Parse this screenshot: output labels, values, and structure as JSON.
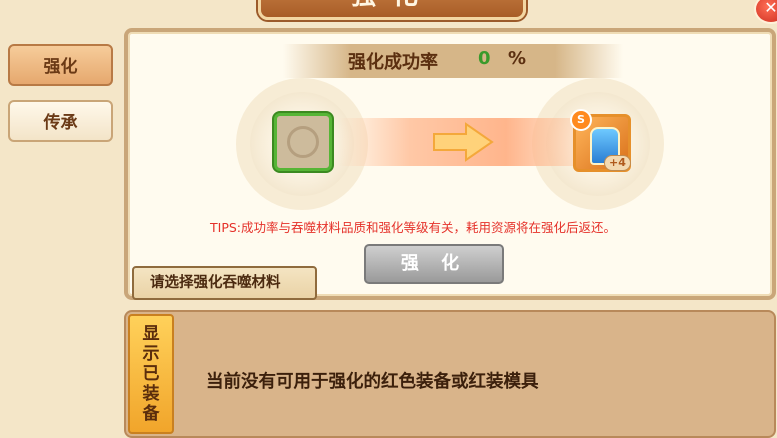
{
  "header": {
    "title": "强化",
    "close_icon": "close-icon"
  },
  "sidebar": {
    "items": [
      {
        "label": "强化",
        "active": true
      },
      {
        "label": "传承",
        "active": false
      }
    ]
  },
  "enhance_panel": {
    "success_rate_label": "强化成功率",
    "success_rate_value": "0",
    "success_rate_unit": "%",
    "target_equipment": {
      "icon": "glove-equipment-icon",
      "grade_badge": "S",
      "level": "+4"
    },
    "material_slot_icon": "empty-slot-icon",
    "arrow_icon": "right-arrow-icon",
    "tips": "TIPS:成功率与吞噬材料品质和强化等级有关，耗用资源将在强化后返还。",
    "enhance_button": "强 化",
    "select_material_label": "请选择强化吞噬材料"
  },
  "equipment_list": {
    "show_equipped_button": "显示已装备",
    "empty_message": "当前没有可用于强化的红色装备或红装模具"
  },
  "colors": {
    "accent": "#e6a86e",
    "tips_red": "#e5312a",
    "rate_green": "#3a9a2b",
    "panel_brown": "#d9b48a"
  }
}
